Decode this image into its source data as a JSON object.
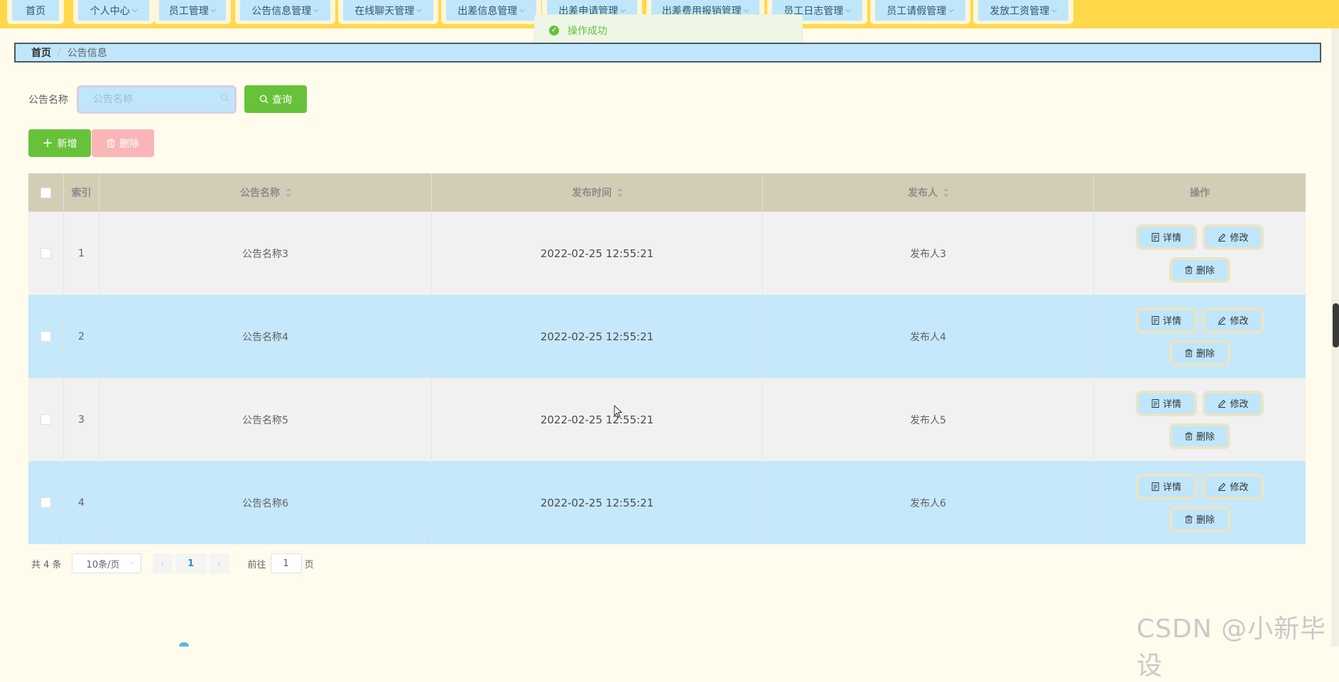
{
  "nav": {
    "items": [
      {
        "label": "首页",
        "dropdown": false
      },
      {
        "label": "个人中心",
        "dropdown": true
      },
      {
        "label": "员工管理",
        "dropdown": true
      },
      {
        "label": "公告信息管理",
        "dropdown": true
      },
      {
        "label": "在线聊天管理",
        "dropdown": true
      },
      {
        "label": "出差信息管理",
        "dropdown": true
      },
      {
        "label": "出差申请管理",
        "dropdown": true
      },
      {
        "label": "出差费用报销管理",
        "dropdown": true
      },
      {
        "label": "员工日志管理",
        "dropdown": true
      },
      {
        "label": "员工请假管理",
        "dropdown": true
      },
      {
        "label": "发放工资管理",
        "dropdown": true
      }
    ]
  },
  "toast": {
    "message": "操作成功",
    "icon": "check-circle-icon"
  },
  "breadcrumb": {
    "home": "首页",
    "separator": "/",
    "current": "公告信息"
  },
  "search": {
    "label": "公告名称",
    "placeholder": "公告名称",
    "value": "",
    "button": "查询"
  },
  "actions": {
    "add": "新增",
    "delete": "删除"
  },
  "table": {
    "headers": {
      "index": "索引",
      "name": "公告名称",
      "time": "发布时间",
      "publisher": "发布人",
      "ops": "操作"
    },
    "rows": [
      {
        "index": "1",
        "name": "公告名称3",
        "time": "2022-02-25 12:55:21",
        "publisher": "发布人3"
      },
      {
        "index": "2",
        "name": "公告名称4",
        "time": "2022-02-25 12:55:21",
        "publisher": "发布人4"
      },
      {
        "index": "3",
        "name": "公告名称5",
        "time": "2022-02-25 12:55:21",
        "publisher": "发布人5"
      },
      {
        "index": "4",
        "name": "公告名称6",
        "time": "2022-02-25 12:55:21",
        "publisher": "发布人6"
      }
    ],
    "row_ops": {
      "detail": "详情",
      "edit": "修改",
      "delete": "删除"
    }
  },
  "pagination": {
    "total": "共 4 条",
    "page_size": "10条/页",
    "current_page": "1",
    "goto_prefix": "前往",
    "goto_value": "1",
    "goto_suffix": "页"
  },
  "watermark": "CSDN @小新毕设",
  "colors": {
    "nav_bg": "#ffd84a",
    "accent_blue": "#bfe6fb",
    "success": "#67c23a",
    "danger_light": "#fab6b6"
  }
}
